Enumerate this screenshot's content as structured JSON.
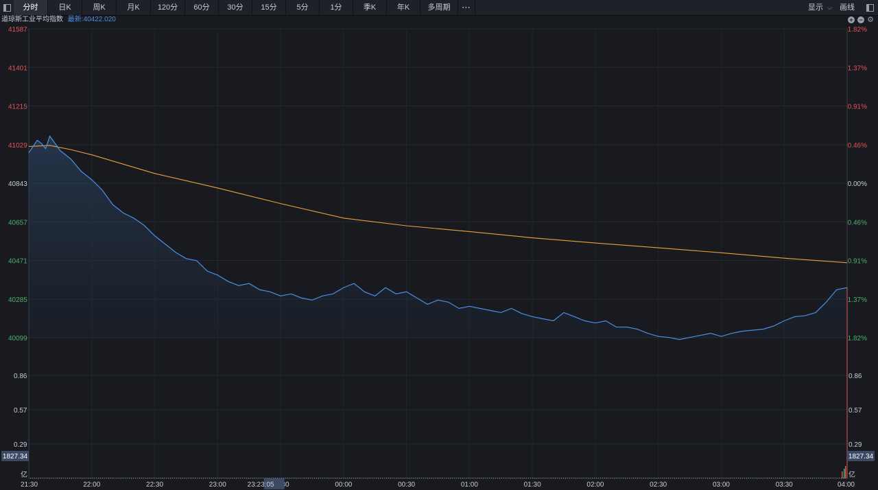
{
  "toolbar": {
    "tabs": [
      "分时",
      "日K",
      "周K",
      "月K",
      "120分",
      "60分",
      "30分",
      "15分",
      "5分",
      "1分",
      "季K",
      "年K",
      "多周期"
    ],
    "active_index": 0,
    "more_label": "⋯",
    "display_label": "显示",
    "draw_label": "画线"
  },
  "header": {
    "name": "道琼斯工业平均指数",
    "latest_label": "最新:40422.020"
  },
  "colors": {
    "price_line": "#4a90e2",
    "avg_line": "#e8a33d",
    "up": "#e05555",
    "down": "#4caf6a",
    "neutral": "#c9ccd2"
  },
  "chart_data": {
    "type": "line",
    "title": "道琼斯工业平均指数",
    "y_ticks_left": [
      "41587",
      "41401",
      "41215",
      "41029",
      "40843",
      "40657",
      "40471",
      "40285",
      "40099"
    ],
    "y_ticks_right": [
      "1.82%",
      "1.37%",
      "0.91%",
      "0.46%",
      "0.00%",
      "0.46%",
      "0.91%",
      "1.37%",
      "1.82%"
    ],
    "ylim": [
      40099,
      41587
    ],
    "reference_price": 40843,
    "volume_ticks": [
      "0.86",
      "0.57",
      "0.29"
    ],
    "volume_unit": "亿",
    "volume_readout": "1827.34",
    "x_tick_labels": [
      "21:30",
      "22:00",
      "22:30",
      "23:00",
      "23:30",
      "00:00",
      "00:30",
      "01:00",
      "01:30",
      "02:00",
      "02:30",
      "03:00",
      "03:30",
      "04:00"
    ],
    "crosshair_time": "23:23:05",
    "series": [
      {
        "x": [
          "21:30",
          "21:32",
          "21:34",
          "21:36",
          "21:38",
          "21:40",
          "21:45",
          "21:50",
          "21:55",
          "22:00",
          "22:05",
          "22:10",
          "22:15",
          "22:20",
          "22:25",
          "22:30",
          "22:35",
          "22:40",
          "22:45",
          "22:50",
          "22:55",
          "23:00",
          "23:05",
          "23:10",
          "23:15",
          "23:20",
          "23:25",
          "23:30",
          "23:35",
          "23:40",
          "23:45",
          "23:50",
          "23:55",
          "00:00",
          "00:05",
          "00:10",
          "00:15",
          "00:20",
          "00:25",
          "00:30",
          "00:35",
          "00:40",
          "00:45",
          "00:50",
          "00:55",
          "01:00",
          "01:05",
          "01:10",
          "01:15",
          "01:20",
          "01:25",
          "01:30",
          "01:35",
          "01:40",
          "01:45",
          "01:50",
          "01:55",
          "02:00",
          "02:05",
          "02:10",
          "02:15",
          "02:20",
          "02:25",
          "02:30",
          "02:35",
          "02:40",
          "02:45",
          "02:50",
          "02:55",
          "03:00",
          "03:05",
          "03:10",
          "03:15",
          "03:20",
          "03:25",
          "03:30",
          "03:35",
          "03:40",
          "03:45",
          "03:50",
          "03:55",
          "04:00"
        ],
        "values": [
          40990,
          41020,
          41050,
          41035,
          41010,
          41070,
          41000,
          40960,
          40900,
          40860,
          40810,
          40740,
          40700,
          40675,
          40640,
          40590,
          40550,
          40510,
          40480,
          40470,
          40420,
          40400,
          40370,
          40350,
          40360,
          40330,
          40320,
          40300,
          40310,
          40290,
          40280,
          40300,
          40310,
          40340,
          40360,
          40320,
          40300,
          40340,
          40310,
          40320,
          40290,
          40260,
          40280,
          40270,
          40240,
          40250,
          40240,
          40230,
          40220,
          40240,
          40215,
          40200,
          40190,
          40180,
          40220,
          40200,
          40180,
          40170,
          40180,
          40150,
          40150,
          40140,
          40120,
          40105,
          40100,
          40090,
          40100,
          40110,
          40120,
          40105,
          40120,
          40130,
          40135,
          40140,
          40155,
          40180,
          40200,
          40205,
          40220,
          40270,
          40330,
          40340
        ]
      },
      {
        "x": [
          "21:30",
          "21:40",
          "21:50",
          "22:00",
          "22:30",
          "23:00",
          "23:30",
          "00:00",
          "00:30",
          "01:00",
          "01:30",
          "02:00",
          "02:30",
          "03:00",
          "03:30",
          "04:00"
        ],
        "values": [
          41020,
          41025,
          41005,
          40980,
          40890,
          40820,
          40745,
          40675,
          40638,
          40610,
          40580,
          40555,
          40532,
          40508,
          40482,
          40460
        ]
      }
    ]
  }
}
